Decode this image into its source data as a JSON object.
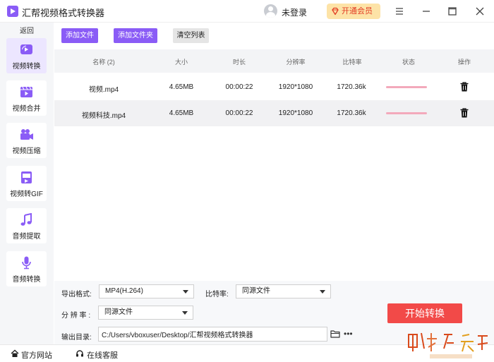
{
  "titlebar": {
    "app_title": "汇帮视频格式转换器",
    "login_label": "未登录",
    "vip_label": "开通会员",
    "icons": [
      "app-logo-icon",
      "user-avatar-icon",
      "diamond-icon",
      "menu-icon",
      "minimize-icon",
      "maximize-icon",
      "close-icon"
    ]
  },
  "sidebar": {
    "back_label": "返回",
    "items": [
      {
        "label": "视频转换",
        "icon": "video-convert-icon",
        "active": true
      },
      {
        "label": "视频合并",
        "icon": "video-merge-icon",
        "active": false
      },
      {
        "label": "视频压缩",
        "icon": "video-compress-icon",
        "active": false
      },
      {
        "label": "视频转GIF",
        "icon": "gif-icon",
        "active": false
      },
      {
        "label": "音频提取",
        "icon": "music-note-icon",
        "active": false
      },
      {
        "label": "音频转换",
        "icon": "microphone-icon",
        "active": false
      }
    ]
  },
  "toolbar": {
    "add_file": "添加文件",
    "add_folder": "添加文件夹",
    "clear_list": "清空列表"
  },
  "table": {
    "headers": {
      "name": "名称 (2)",
      "size": "大小",
      "duration": "时长",
      "resolution": "分辨率",
      "bitrate": "比特率",
      "status": "状态",
      "action": "操作"
    },
    "rows": [
      {
        "name": "视频.mp4",
        "size": "4.65MB",
        "duration": "00:00:22",
        "resolution": "1920*1080",
        "bitrate": "1720.36k",
        "selected": false
      },
      {
        "name": "视频科技.mp4",
        "size": "4.65MB",
        "duration": "00:00:22",
        "resolution": "1920*1080",
        "bitrate": "1720.36k",
        "selected": true
      }
    ]
  },
  "settings": {
    "format_label": "导出格式:",
    "format_value": "MP4(H.264)",
    "bitrate_label": "比特率:",
    "bitrate_value": "同源文件",
    "resolution_label": "分 辨 率 :",
    "resolution_value": "同源文件",
    "output_label": "输出目录:",
    "output_path": "C:/Users/vboxuser/Desktop/汇帮视频格式转换器",
    "more_label": "•••",
    "start_label": "开始转换"
  },
  "footer": {
    "website_label": "官方网站",
    "support_label": "在线客服"
  },
  "colors": {
    "accent": "#8a5cf6",
    "start_button": "#f24a48",
    "vip_bg": "#fde3a7",
    "vip_text": "#e23c24",
    "progress": "#f3a9bb"
  }
}
